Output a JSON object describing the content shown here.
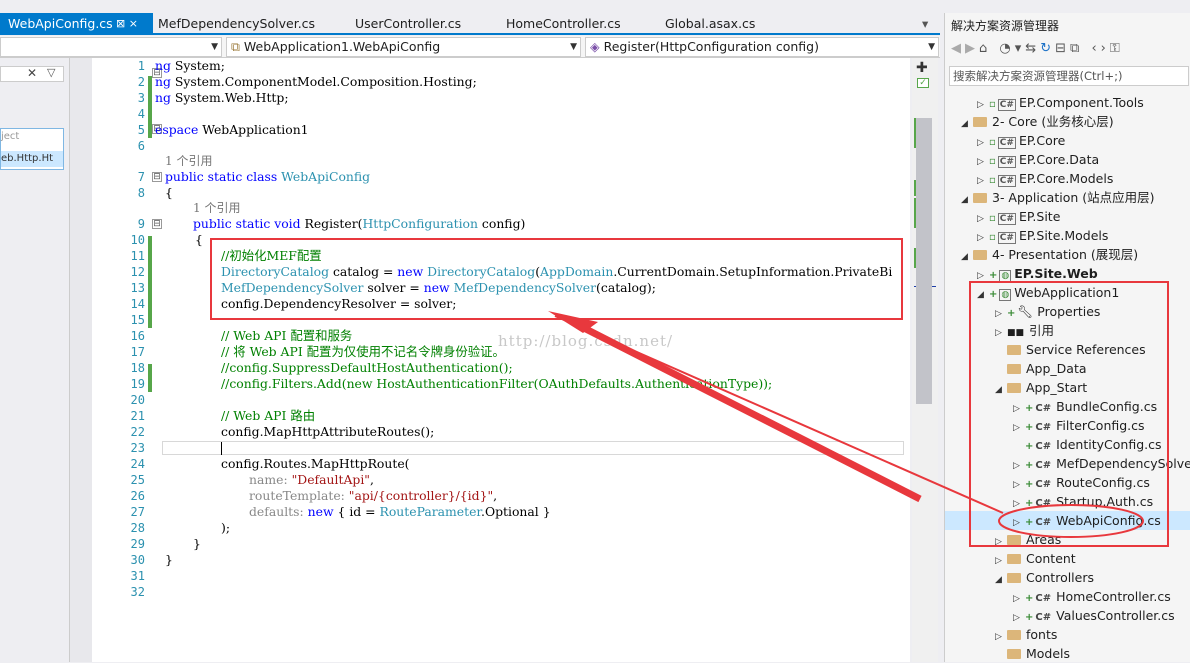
{
  "tabs": [
    {
      "label": "WebApiConfig.cs",
      "pin": "⊠ ×"
    },
    {
      "label": "MefDependencySolver.cs"
    },
    {
      "label": "UserController.cs"
    },
    {
      "label": "HomeController.cs"
    },
    {
      "label": "Global.asax.cs"
    }
  ],
  "nav": {
    "project_combo": "",
    "class_combo": "WebApplication1.WebApiConfig",
    "member_combo": "Register(HttpConfiguration config)"
  },
  "left": {
    "item1": "ject",
    "item2": "eb.Http.Ht"
  },
  "code": {
    "line_numbers": [
      "1",
      "2",
      "3",
      "4",
      "5",
      "6",
      "7",
      "8",
      "9",
      "10",
      "11",
      "12",
      "13",
      "14",
      "15",
      "16",
      "17",
      "18",
      "19",
      "20",
      "21",
      "22",
      "23",
      "24",
      "25",
      "26",
      "27",
      "28",
      "29",
      "30",
      "31",
      "32"
    ],
    "ref_label": "1 个引用",
    "l1": [
      "ng",
      " System;"
    ],
    "l2": [
      "ng",
      " System.ComponentModel.Composition.Hosting;"
    ],
    "l3": [
      "ng",
      " System.Web.Http;"
    ],
    "l5": [
      "espace",
      " WebApplication1"
    ],
    "l7": [
      "public static class ",
      "WebApiConfig"
    ],
    "l8": "{",
    "l9": [
      "public static void ",
      "Register(",
      "HttpConfiguration",
      " config)"
    ],
    "l10": "{",
    "l11": "//初始化MEF配置",
    "l12": [
      "DirectoryCatalog",
      " catalog = ",
      "new ",
      "DirectoryCatalog",
      "(",
      "AppDomain",
      ".CurrentDomain.SetupInformation.PrivateBi"
    ],
    "l13": [
      "MefDependencySolver",
      " solver = ",
      "new ",
      "MefDependencySolver",
      "(catalog);"
    ],
    "l14": "config.DependencyResolver = solver;",
    "l16": "// Web API 配置和服务",
    "l17": "// 将 Web API 配置为仅使用不记名令牌身份验证。",
    "l18": "//config.SuppressDefaultHostAuthentication();",
    "l19": "//config.Filters.Add(new HostAuthenticationFilter(OAuthDefaults.AuthenticationType));",
    "l21": "// Web API 路由",
    "l22": "config.MapHttpAttributeRoutes();",
    "l24": "config.Routes.MapHttpRoute(",
    "l25": [
      "name: ",
      "\"DefaultApi\"",
      ","
    ],
    "l26": [
      "routeTemplate: ",
      "\"api/{controller}/{id}\"",
      ","
    ],
    "l27": [
      "defaults: ",
      "new ",
      "{ id = ",
      "RouteParameter",
      ".Optional }"
    ],
    "l28": ");",
    "l29": "}",
    "l30": "}"
  },
  "watermark": "http://blog.csdn.net/",
  "solution": {
    "title": "解决方案资源管理器",
    "search_placeholder": "搜索解决方案资源管理器(Ctrl+;)",
    "items": [
      "EP.Component.Tools",
      "2- Core (业务核心层)",
      "EP.Core",
      "EP.Core.Data",
      "EP.Core.Models",
      "3- Application (站点应用层)",
      "EP.Site",
      "EP.Site.Models",
      "4- Presentation (展现层)",
      "EP.Site.Web",
      "WebApplication1",
      "Properties",
      "引用",
      "Service References",
      "App_Data",
      "App_Start",
      "BundleConfig.cs",
      "FilterConfig.cs",
      "IdentityConfig.cs",
      "MefDependencySolver.cs",
      "RouteConfig.cs",
      "Startup.Auth.cs",
      "WebApiConfig.cs",
      "Areas",
      "Content",
      "Controllers",
      "HomeController.cs",
      "ValuesController.cs",
      "fonts",
      "Models"
    ]
  },
  "colors": {
    "accent": "#007acc",
    "annotation": "#e8383d",
    "selected": "#cce8ff"
  }
}
